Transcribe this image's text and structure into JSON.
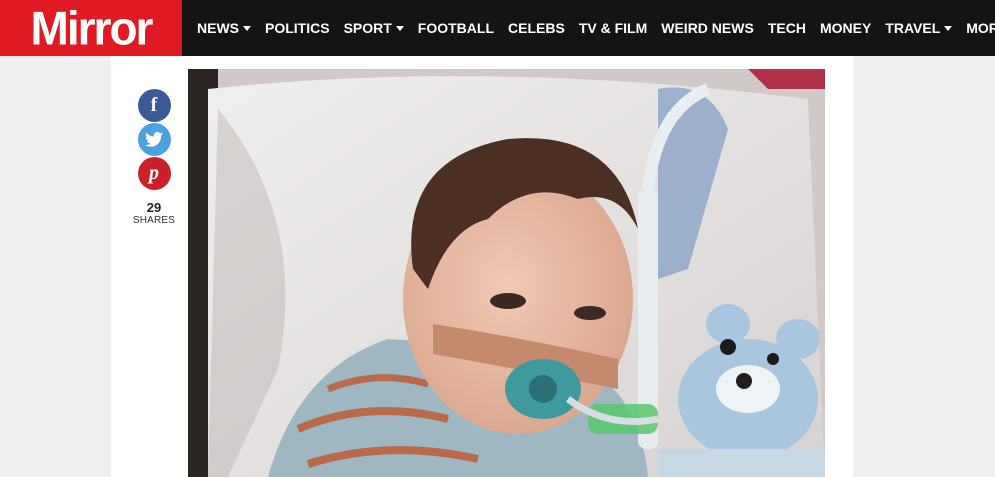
{
  "brand": {
    "logo_text": "Mirror",
    "colors": {
      "red": "#e01a22",
      "nav_bg": "#141414"
    }
  },
  "nav": {
    "items": [
      {
        "label": "NEWS",
        "dropdown": true
      },
      {
        "label": "POLITICS",
        "dropdown": false
      },
      {
        "label": "SPORT",
        "dropdown": true
      },
      {
        "label": "FOOTBALL",
        "dropdown": false
      },
      {
        "label": "CELEBS",
        "dropdown": false
      },
      {
        "label": "TV & FILM",
        "dropdown": false
      },
      {
        "label": "WEIRD NEWS",
        "dropdown": false
      },
      {
        "label": "TECH",
        "dropdown": false
      },
      {
        "label": "MONEY",
        "dropdown": false
      },
      {
        "label": "TRAVEL",
        "dropdown": true
      },
      {
        "label": "MORE",
        "dropdown": true
      }
    ]
  },
  "share": {
    "buttons": [
      {
        "network": "facebook",
        "icon": "facebook-icon",
        "glyph": "f"
      },
      {
        "network": "twitter",
        "icon": "twitter-icon"
      },
      {
        "network": "pinterest",
        "icon": "pinterest-icon",
        "glyph": "p"
      }
    ],
    "count": "29",
    "label": "SHARES"
  }
}
